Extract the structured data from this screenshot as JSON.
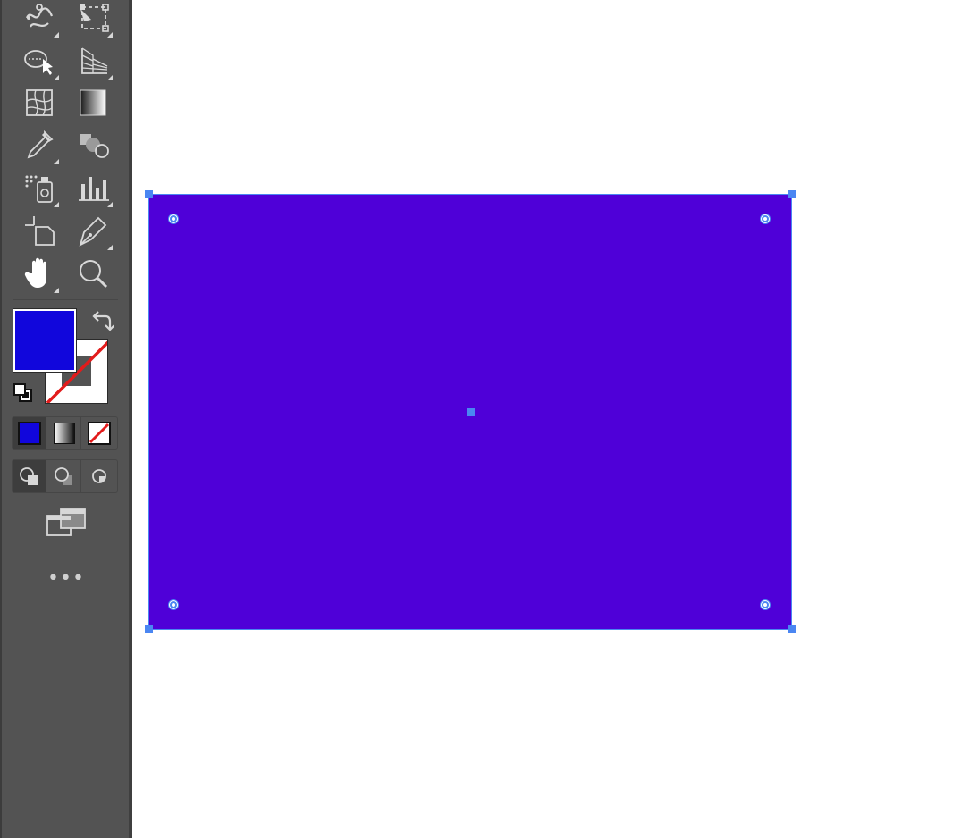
{
  "toolbar": {
    "more_label": "•••",
    "tools": [
      {
        "name": "puppet-warp-icon",
        "flyout": true
      },
      {
        "name": "free-transform-icon",
        "flyout": true
      },
      {
        "name": "shape-builder-icon",
        "flyout": true
      },
      {
        "name": "perspective-grid-icon",
        "flyout": true
      },
      {
        "name": "mesh-icon",
        "flyout": false
      },
      {
        "name": "gradient-icon",
        "flyout": false
      },
      {
        "name": "eyedropper-icon",
        "flyout": true
      },
      {
        "name": "blend-icon",
        "flyout": false
      },
      {
        "name": "symbol-sprayer-icon",
        "flyout": true
      },
      {
        "name": "column-graph-icon",
        "flyout": true
      },
      {
        "name": "artboard-icon",
        "flyout": false
      },
      {
        "name": "pen-icon",
        "flyout": true
      },
      {
        "name": "hand-icon",
        "flyout": true
      },
      {
        "name": "zoom-icon",
        "flyout": false
      }
    ]
  },
  "colors": {
    "fill": "#1106dc",
    "stroke": "none",
    "shape_fill": "#4f00d8",
    "selection": "#4a86f2",
    "panel": "#535353"
  }
}
